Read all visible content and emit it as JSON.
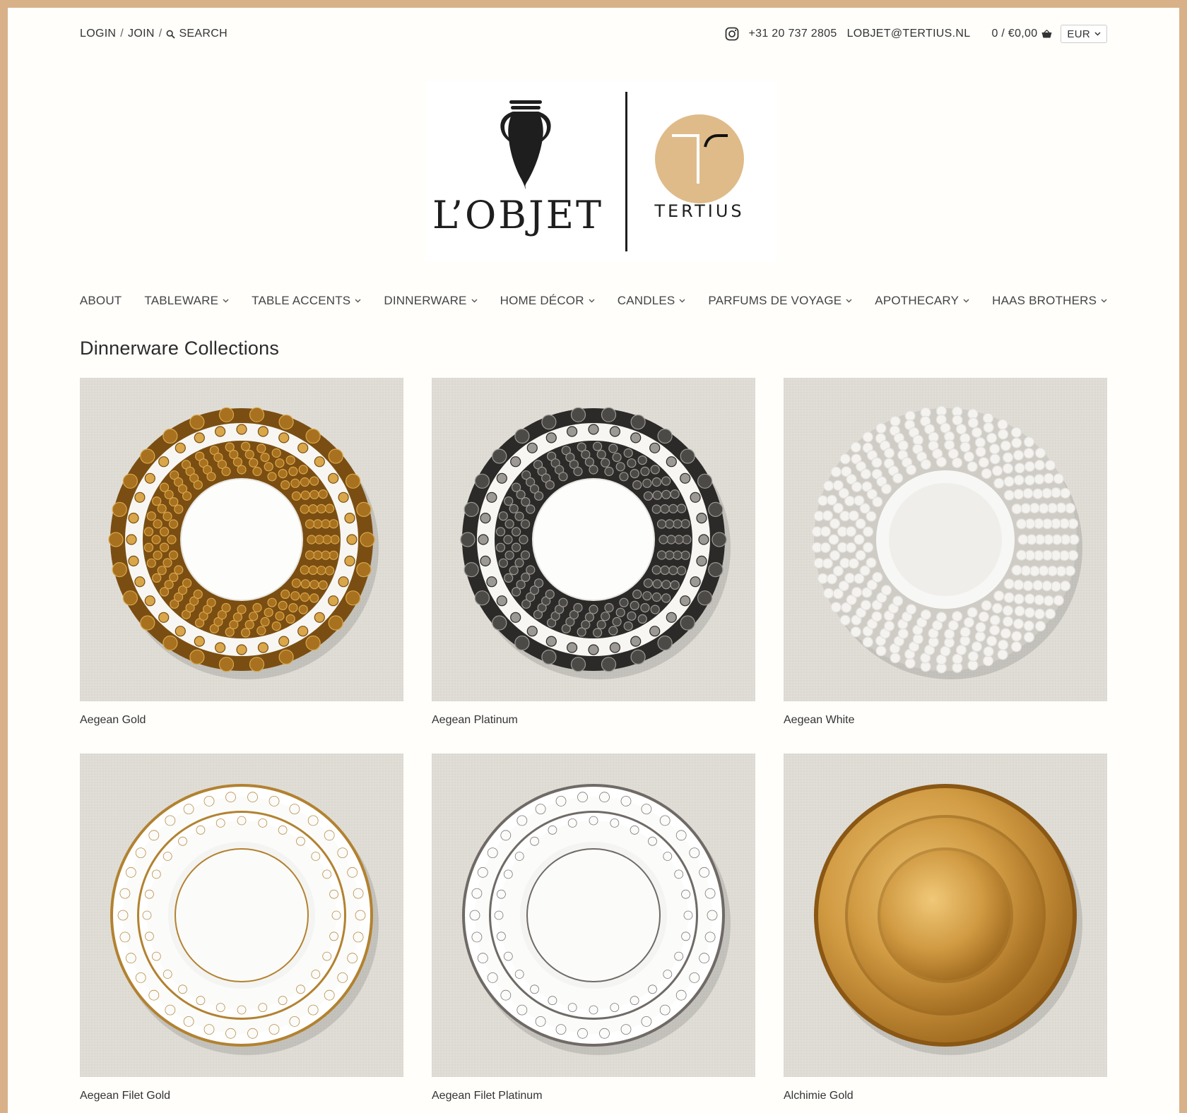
{
  "topbar": {
    "login": "LOGIN",
    "join": "JOIN",
    "sep": "/",
    "search": "SEARCH",
    "phone": "+31 20 737 2805",
    "email": "LOBJET@TERTIUS.NL",
    "cart": "0 / €0,00",
    "currency": "EUR"
  },
  "logo": {
    "brand": "L’OBJET",
    "partner": "TERTIUS"
  },
  "nav": [
    {
      "label": "ABOUT"
    },
    {
      "label": "TABLEWARE"
    },
    {
      "label": "TABLE ACCENTS"
    },
    {
      "label": "DINNERWARE"
    },
    {
      "label": "HOME DÉCOR"
    },
    {
      "label": "CANDLES"
    },
    {
      "label": "PARFUMS DE VOYAGE"
    },
    {
      "label": "APOTHECARY"
    },
    {
      "label": "HAAS BROTHERS"
    }
  ],
  "page": {
    "title": "Dinnerware Collections"
  },
  "products": [
    {
      "name": "Aegean Gold",
      "style": "scales",
      "colors": [
        "#a7711f",
        "#d9a64a",
        "#7a4e12"
      ]
    },
    {
      "name": "Aegean Platinum",
      "style": "scales",
      "colors": [
        "#4c4a47",
        "#9c9893",
        "#2b2a28"
      ]
    },
    {
      "name": "Aegean White",
      "style": "white",
      "colors": [
        "#f4f3f0",
        "#e2e0db",
        "#cfccc6"
      ]
    },
    {
      "name": "Aegean Filet Gold",
      "style": "filet",
      "colors": [
        "#b28230",
        "#ffffff",
        "#8b611d"
      ]
    },
    {
      "name": "Aegean Filet Platinum",
      "style": "filet",
      "colors": [
        "#6f6a66",
        "#ffffff",
        "#4d4946"
      ]
    },
    {
      "name": "Alchimie Gold",
      "style": "alchimie",
      "colors": [
        "#c4862b",
        "#e4ac4c",
        "#8a5714"
      ]
    }
  ],
  "colors": {
    "frame": "#d8b188",
    "background": "#fffefb",
    "tertius_circle": "#dfbb8a"
  }
}
